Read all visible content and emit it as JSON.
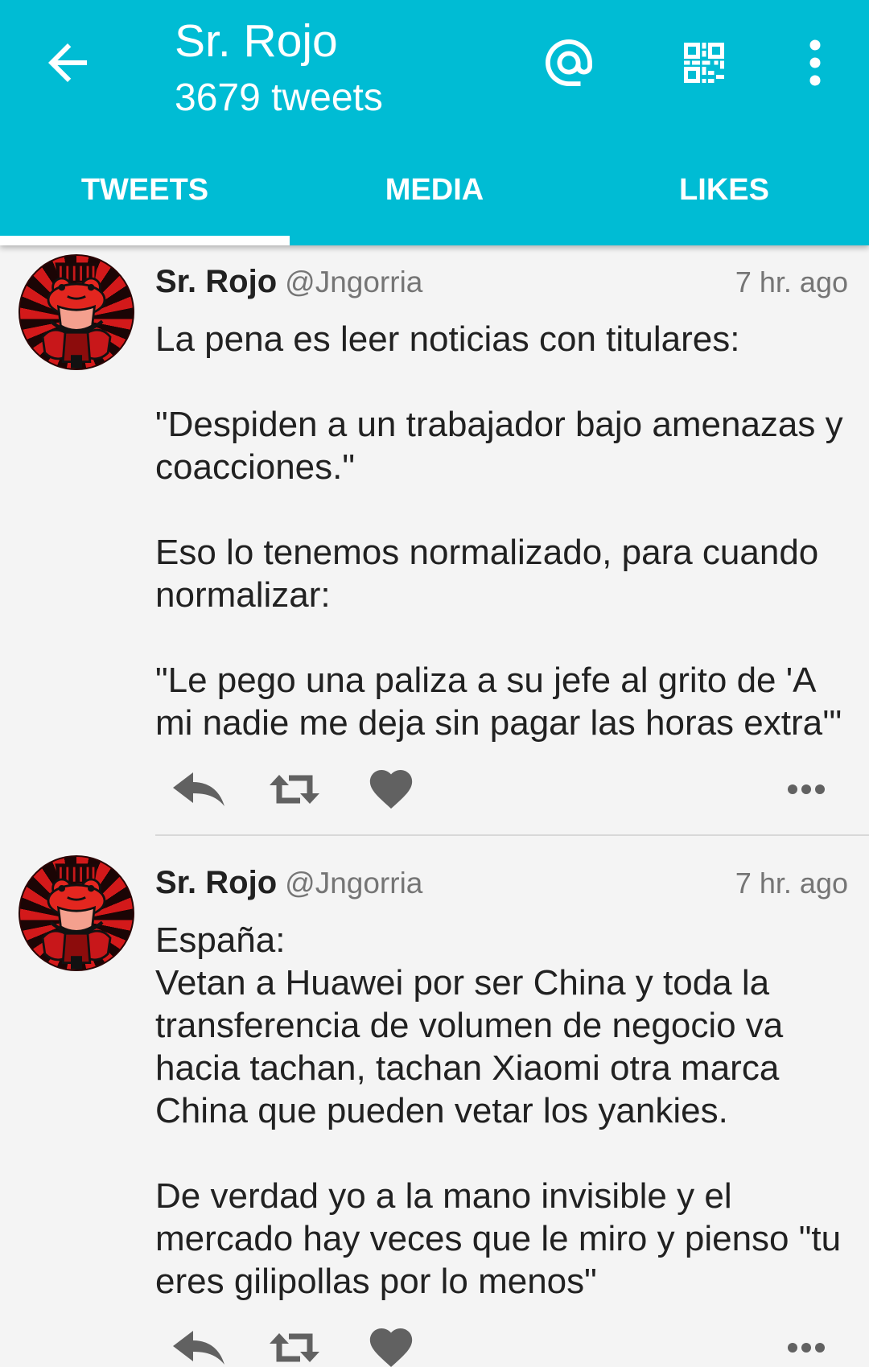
{
  "colors": {
    "appbar": "#00BCD4",
    "appbar_text": "#FFFFFF",
    "primary_text": "#212121",
    "secondary_text": "#757575",
    "action_icon": "#616161",
    "background": "#F4F4F4"
  },
  "header": {
    "title": "Sr. Rojo",
    "subtitle": "3679 tweets",
    "back_icon": "arrow-back-icon",
    "mention_icon": "at-sign-icon",
    "qr_icon": "qr-code-icon",
    "more_icon": "more-vertical-icon"
  },
  "tabs": [
    {
      "label": "TWEETS",
      "selected": true
    },
    {
      "label": "MEDIA",
      "selected": false
    },
    {
      "label": "LIKES",
      "selected": false
    }
  ],
  "tweets": [
    {
      "name": "Sr. Rojo",
      "handle": "@Jngorria",
      "time": "7 hr. ago",
      "text": "La pena es leer noticias con titulares:\n\n\"Despiden a un trabajador bajo amenazas y coacciones.\"\n\nEso lo tenemos normalizado, para cuando normalizar:\n\n\"Le pego una paliza a su jefe al grito de 'A mi nadie me deja sin pagar las horas extra'\"",
      "action_icons": [
        "reply-icon",
        "retweet-icon",
        "heart-icon",
        "more-horizontal-icon"
      ]
    },
    {
      "name": "Sr. Rojo",
      "handle": "@Jngorria",
      "time": "7 hr. ago",
      "text": "España:\nVetan a Huawei por ser China y toda la transferencia de volumen de negocio va hacia tachan, tachan Xiaomi otra marca China que pueden vetar los yankies.\n\nDe verdad yo a la mano invisible y el mercado hay veces que le miro y pienso \"tu eres gilipollas por lo menos\"",
      "action_icons": [
        "reply-icon",
        "retweet-icon",
        "heart-icon",
        "more-horizontal-icon"
      ]
    }
  ]
}
